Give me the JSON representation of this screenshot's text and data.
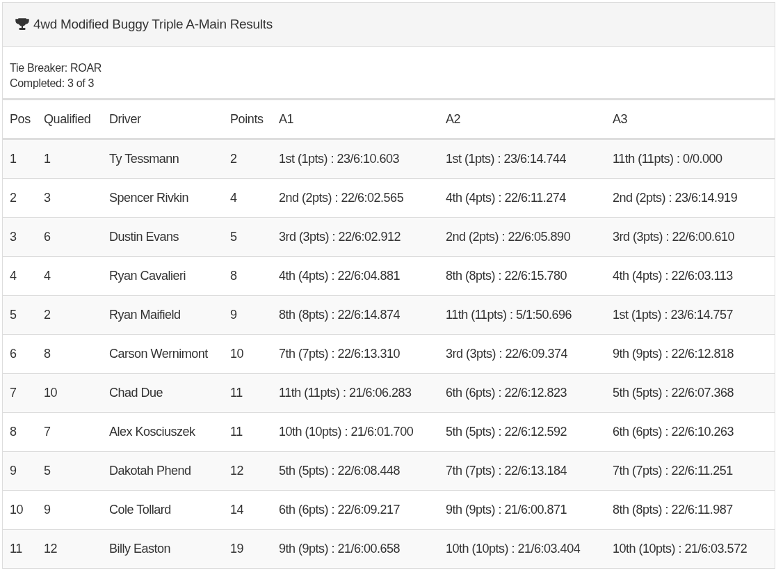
{
  "panel": {
    "title": "4wd Modified Buggy Triple A-Main Results"
  },
  "info": [
    "Tie Breaker: ROAR",
    "Completed: 3 of 3"
  ],
  "table": {
    "columns": [
      "Pos",
      "Qualified",
      "Driver",
      "Points",
      "A1",
      "A2",
      "A3"
    ],
    "rows": [
      [
        "1",
        "1",
        "Ty Tessmann",
        "2",
        "1st (1pts) : 23/6:10.603",
        "1st (1pts) : 23/6:14.744",
        "11th (11pts) : 0/0.000"
      ],
      [
        "2",
        "3",
        "Spencer Rivkin",
        "4",
        "2nd (2pts) : 22/6:02.565",
        "4th (4pts) : 22/6:11.274",
        "2nd (2pts) : 23/6:14.919"
      ],
      [
        "3",
        "6",
        "Dustin Evans",
        "5",
        "3rd (3pts) : 22/6:02.912",
        "2nd (2pts) : 22/6:05.890",
        "3rd (3pts) : 22/6:00.610"
      ],
      [
        "4",
        "4",
        "Ryan Cavalieri",
        "8",
        "4th (4pts) : 22/6:04.881",
        "8th (8pts) : 22/6:15.780",
        "4th (4pts) : 22/6:03.113"
      ],
      [
        "5",
        "2",
        "Ryan Maifield",
        "9",
        "8th (8pts) : 22/6:14.874",
        "11th (11pts) : 5/1:50.696",
        "1st (1pts) : 23/6:14.757"
      ],
      [
        "6",
        "8",
        "Carson Wernimont",
        "10",
        "7th (7pts) : 22/6:13.310",
        "3rd (3pts) : 22/6:09.374",
        "9th (9pts) : 22/6:12.818"
      ],
      [
        "7",
        "10",
        "Chad Due",
        "11",
        "11th (11pts) : 21/6:06.283",
        "6th (6pts) : 22/6:12.823",
        "5th (5pts) : 22/6:07.368"
      ],
      [
        "8",
        "7",
        "Alex Kosciuszek",
        "11",
        "10th (10pts) : 21/6:01.700",
        "5th (5pts) : 22/6:12.592",
        "6th (6pts) : 22/6:10.263"
      ],
      [
        "9",
        "5",
        "Dakotah Phend",
        "12",
        "5th (5pts) : 22/6:08.448",
        "7th (7pts) : 22/6:13.184",
        "7th (7pts) : 22/6:11.251"
      ],
      [
        "10",
        "9",
        "Cole Tollard",
        "14",
        "6th (6pts) : 22/6:09.217",
        "9th (9pts) : 21/6:00.871",
        "8th (8pts) : 22/6:11.987"
      ],
      [
        "11",
        "12",
        "Billy Easton",
        "19",
        "9th (9pts) : 21/6:00.658",
        "10th (10pts) : 21/6:03.404",
        "10th (10pts) : 21/6:03.572"
      ]
    ]
  }
}
